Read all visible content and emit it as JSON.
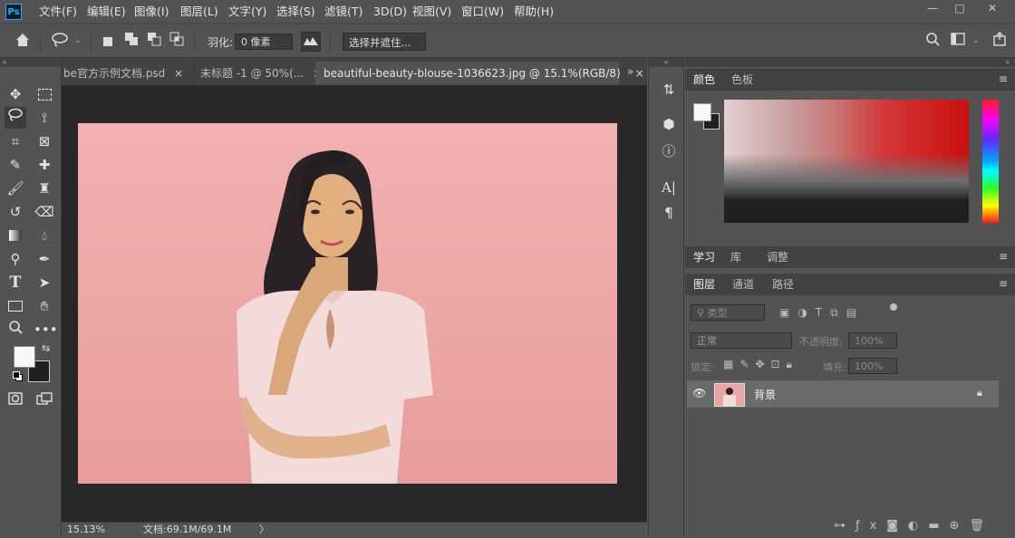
{
  "app": {
    "logo": "Ps"
  },
  "menu": [
    "文件(F)",
    "编辑(E)",
    "图像(I)",
    "图层(L)",
    "文字(Y)",
    "选择(S)",
    "滤镜(T)",
    "3D(D)",
    "视图(V)",
    "窗口(W)",
    "帮助(H)"
  ],
  "window_controls": {
    "minimize": "—",
    "restore": "□",
    "close": "✕"
  },
  "options": {
    "feather_label": "羽化:",
    "feather_value": "0 像素",
    "select_mask_label": "选择并遮住..."
  },
  "tabs": [
    {
      "label": "be官方示例文档.psd",
      "close": "×",
      "active": false
    },
    {
      "label": "未标题 -1 @ 50%(...",
      "close": "×",
      "active": false
    },
    {
      "label": "beautiful-beauty-blouse-1036623.jpg @ 15.1%(RGB/8)",
      "close": "×",
      "active": true
    }
  ],
  "status": {
    "zoom": "15.13%",
    "doc_size": "文档:69.1M/69.1M",
    "arrow": "〉"
  },
  "color_panel": {
    "tabs": [
      "颜色",
      "色板"
    ],
    "active": "颜色",
    "foreground": "#f7f7f7",
    "background": "#202020"
  },
  "learn_panel": {
    "tabs": [
      "学习",
      "库",
      "调整"
    ],
    "active": "学习"
  },
  "layers_panel": {
    "tabs": [
      "图层",
      "通道",
      "路径"
    ],
    "active": "图层",
    "filter_placeholder": "类型",
    "blend_mode": "正常",
    "opacity_label": "不透明度:",
    "opacity_value": "100%",
    "lock_label": "锁定:",
    "fill_label": "填充:",
    "fill_value": "100%",
    "layers": [
      {
        "name": "背景",
        "visible": true,
        "locked": true
      }
    ]
  },
  "colors": {
    "accent_pink": "#eca5a5",
    "panel_bg": "#535353",
    "canvas_bg": "#282828",
    "ps_blue": "#31a8ff"
  }
}
